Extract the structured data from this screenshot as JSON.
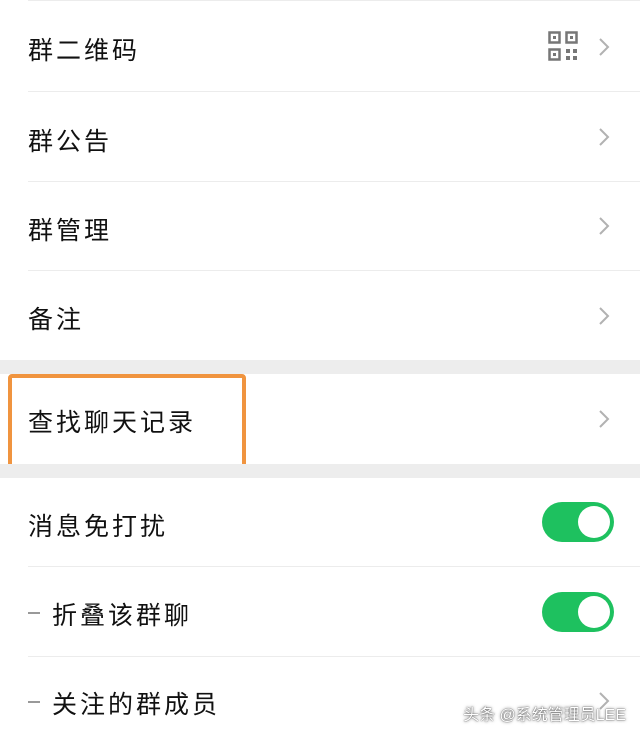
{
  "menu": {
    "qr_code": "群二维码",
    "announcement": "群公告",
    "management": "群管理",
    "remark": "备注",
    "search_history": "查找聊天记录",
    "mute": "消息免打扰",
    "fold": "折叠该群聊",
    "followed_members": "关注的群成员"
  },
  "toggles": {
    "mute_on": true,
    "fold_on": true
  },
  "colors": {
    "toggle_on": "#1ec15f",
    "highlight_border": "#f0943f",
    "section_gap": "#ededed"
  },
  "watermark": "头条 @系统管理员LEE"
}
